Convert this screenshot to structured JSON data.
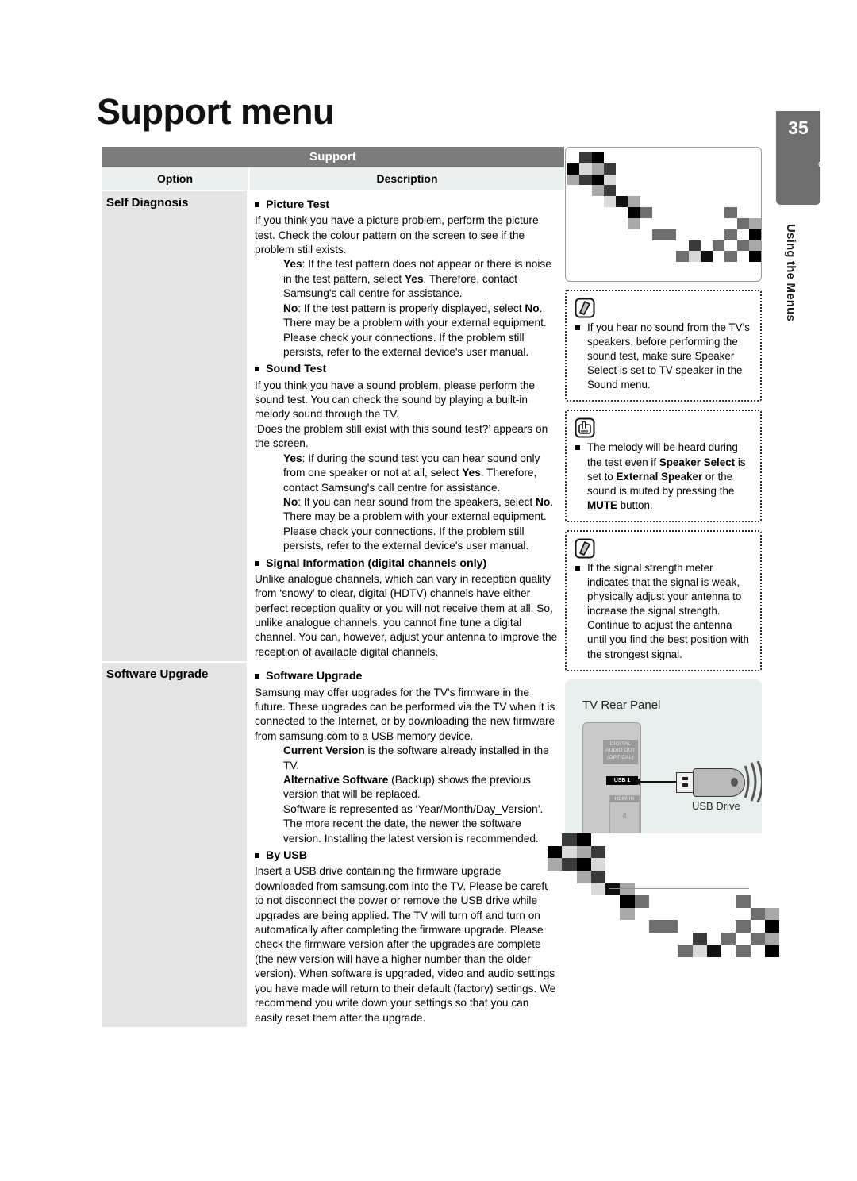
{
  "page": {
    "title": "Support menu",
    "number": "35",
    "language": "English",
    "section": "Using the Menus"
  },
  "table": {
    "title": "Support",
    "columns": [
      "Option",
      "Description"
    ],
    "rows": [
      {
        "option": "Self Diagnosis",
        "blocks": [
          {
            "type": "subhead",
            "text": "Picture Test"
          },
          {
            "type": "para",
            "text": "If you think you have a picture problem, perform the picture test. Check the colour pattern on the screen to see if the problem still exists."
          },
          {
            "type": "para-indent",
            "html": "<b>Yes</b>: If the test pattern does not appear or there is noise in the test pattern, select <b>Yes</b>. Therefore, contact Samsung's call centre for assistance."
          },
          {
            "type": "para-indent",
            "html": "<b>No</b>: If the test pattern is properly displayed, select <b>No</b>. There may be a problem with your external equipment. Please check your connections. If the problem still persists, refer to the external device's user manual."
          },
          {
            "type": "subhead",
            "text": "Sound Test"
          },
          {
            "type": "para",
            "text": "If you think you have a sound problem, please perform the sound test. You can check the sound by playing a built-in melody sound through the TV."
          },
          {
            "type": "para",
            "text": "‘Does the problem still exist with this sound test?’ appears on the screen."
          },
          {
            "type": "para-indent",
            "html": "<b>Yes</b>: If during the sound test you can hear sound only from one speaker or not at all, select <b>Yes</b>. Therefore, contact Samsung's call centre for assistance."
          },
          {
            "type": "para-indent",
            "html": "<b>No</b>: If you can hear sound from the speakers, select <b>No</b>. There may be a problem with your external equipment. Please check your connections. If the problem still persists, refer to the external device's user manual."
          },
          {
            "type": "subhead",
            "text": "Signal Information (digital channels only)"
          },
          {
            "type": "para",
            "text": "Unlike analogue channels, which can vary in reception quality from ‘snowy’ to clear, digital (HDTV) channels have either perfect reception quality or you will not receive them at all. So, unlike analogue channels, you cannot fine tune a digital channel. You can, however, adjust your antenna to improve the reception of available digital channels."
          }
        ]
      },
      {
        "option": "Software Upgrade",
        "blocks": [
          {
            "type": "subhead",
            "text": "Software Upgrade"
          },
          {
            "type": "para",
            "text": "Samsung may offer upgrades for the TV's firmware in the future. These upgrades can be performed via the TV when it is connected to the Internet, or by downloading the new firmware from samsung.com to a USB memory device."
          },
          {
            "type": "para-indent",
            "html": "<b>Current Version</b> is the software already installed in the TV."
          },
          {
            "type": "para-indent",
            "html": "<b>Alternative Software</b> (Backup) shows the previous version that will be replaced."
          },
          {
            "type": "para-indent",
            "html": "Software is represented as ‘Year/Month/Day_Version’. The more recent the date, the newer the software version. Installing the latest version is recommended."
          },
          {
            "type": "subhead",
            "text": "By USB"
          },
          {
            "type": "para",
            "text": "Insert a USB drive containing the firmware upgrade downloaded from samsung.com into the TV. Please be careful to not disconnect the power or remove the USB drive while upgrades are being applied. The TV will turn off and turn on automatically after completing the firmware upgrade. Please check the firmware version after the upgrades are complete (the new version will have a higher number than the older version). When software is upgraded, video and audio settings you have made will return to their default (factory) settings. We recommend you write down your settings so that you can easily reset them after the upgrade."
          }
        ]
      }
    ]
  },
  "notes": [
    {
      "icon": "note-pencil-icon",
      "html": "If you hear no sound from the TV’s speakers, before performing the sound test, make sure Speaker Select is set to TV speaker in the Sound menu."
    },
    {
      "icon": "hand-press-button-icon",
      "html": "The melody will be heard during the test even if <b>Speaker Select</b> is set to <b>External Speaker</b> or the sound is muted by pressing the <b>MUTE</b> button."
    },
    {
      "icon": "note-pencil-icon",
      "html": "If the signal strength meter indicates that the signal is weak, physically adjust your antenna to increase the signal strength. Continue to adjust the antenna until you find the best position with the strongest signal."
    }
  ],
  "figure": {
    "title": "TV Rear Panel",
    "port_optical": "DIGITAL AUDIO OUT (OPTICAL)",
    "port_usb": "USB 1",
    "port_hdmi": "HDMI IN",
    "port_hdmi_number": "4",
    "device_label": "USB Drive"
  },
  "colors": {
    "table_title_bg": "#7b7b7b",
    "column_head_bg": "#e9f0ef",
    "option_cell_bg": "#e4e4e4",
    "marker_bg": "#6e6e6e",
    "figure_bg": "#e6efee"
  }
}
